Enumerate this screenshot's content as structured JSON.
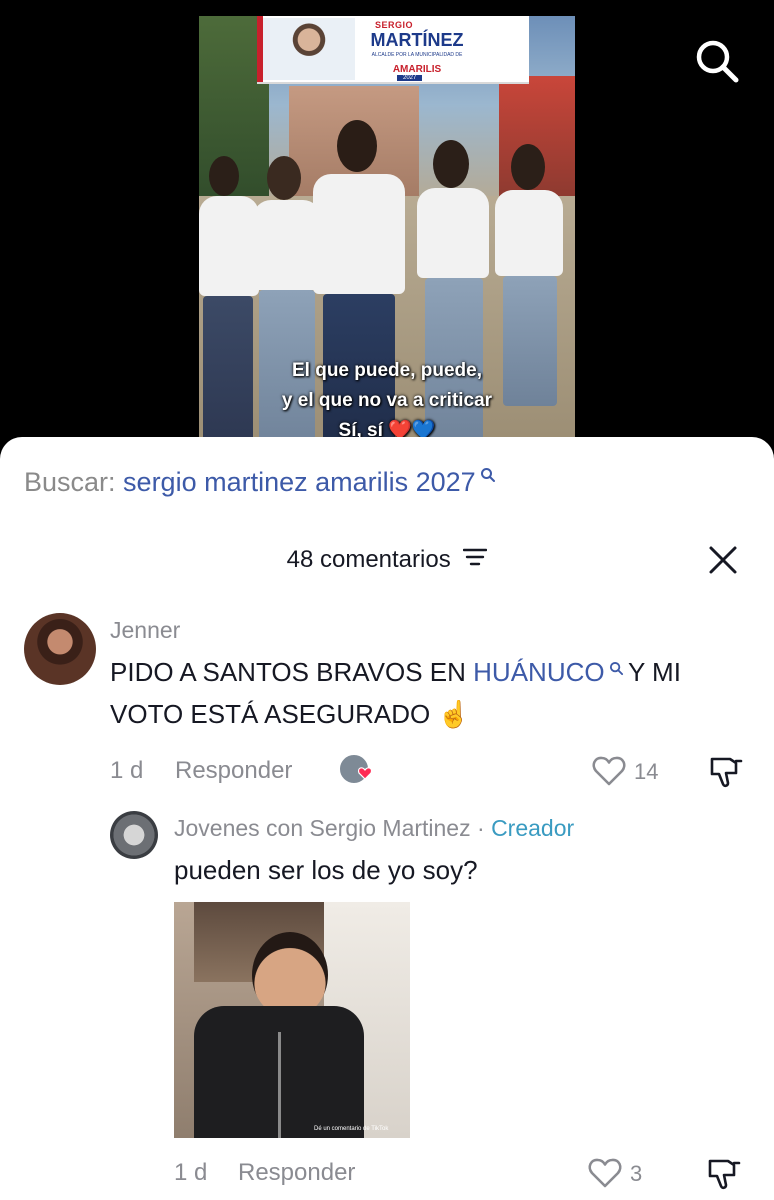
{
  "video": {
    "banner": {
      "first_name": "SERGIO",
      "last_name": "MARTÍNEZ",
      "subtitle": "ALCALDE POR LA MUNICIPALIDAD DE",
      "place": "AMARILIS",
      "year": "2027"
    },
    "caption_lines": [
      "El que puede, puede,",
      "y el que no va a criticar",
      "Sí, sí ❤️💙"
    ]
  },
  "top_bar": {
    "search_icon": "search-icon"
  },
  "search_suggestion": {
    "prefix": "Buscar: ",
    "term": "sergio martinez amarilis 2027",
    "icon": "search-icon"
  },
  "comments_header": {
    "count_label": "48 comentarios",
    "filter_icon": "filter-icon",
    "close_icon": "close-icon"
  },
  "comments": [
    {
      "username": "Jenner",
      "text_before": "PIDO A SANTOS BRAVOS EN ",
      "mention": "HUÁNUCO",
      "text_after": " Y MI VOTO ESTÁ ASEGURADO ☝️",
      "time": "1 d",
      "reply_label": "Responder",
      "likes": "14",
      "liked_by_creator": true
    }
  ],
  "replies": [
    {
      "username": "Jovenes con Sergio Martinez",
      "separator": "·",
      "badge": "Creador",
      "text": "pueden ser los de yo soy?",
      "time": "1 d",
      "reply_label": "Responder",
      "likes": "3",
      "gif_watermark": "Dé un comentario de TikTok"
    }
  ],
  "colors": {
    "link_blue": "#3d5aa8",
    "creator_blue": "#3a9bc1",
    "heart_red": "#fe2c55",
    "muted_gray": "#8a8b91"
  }
}
